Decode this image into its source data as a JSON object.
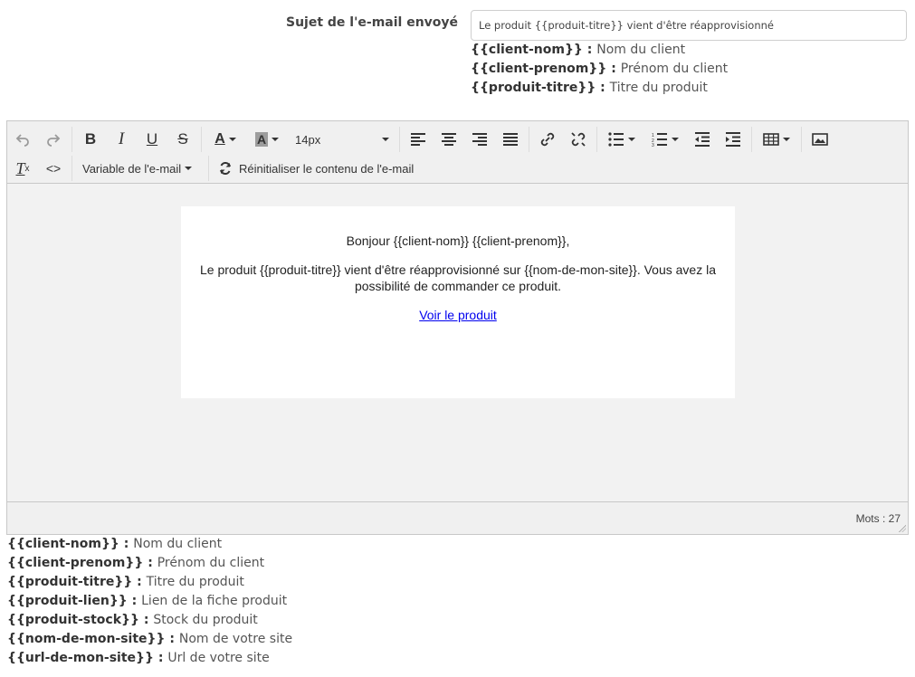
{
  "subject": {
    "label": "Sujet de l'e-mail envoyé",
    "value": "Le produit {{produit-titre}} vient d'être réapprovisionné"
  },
  "subject_vars": [
    {
      "var": "{{client-nom}}",
      "sep": " : ",
      "desc": "Nom du client"
    },
    {
      "var": "{{client-prenom}}",
      "sep": " : ",
      "desc": "Prénom du client"
    },
    {
      "var": "{{produit-titre}}",
      "sep": " : ",
      "desc": "Titre du produit"
    }
  ],
  "toolbar": {
    "font_size": "14px",
    "variable_menu": "Variable de l'e-mail",
    "reset_button": "Réinitialiser le contenu de l'e-mail",
    "icons": [
      "undo-icon",
      "redo-icon",
      "bold-icon",
      "italic-icon",
      "underline-icon",
      "strikethrough-icon",
      "text-color-icon",
      "background-color-icon",
      "align-left-icon",
      "align-center-icon",
      "align-right-icon",
      "justify-icon",
      "link-icon",
      "unlink-icon",
      "bullet-list-icon",
      "numbered-list-icon",
      "outdent-icon",
      "indent-icon",
      "table-icon",
      "image-icon",
      "clear-formatting-icon",
      "source-code-icon",
      "refresh-icon"
    ]
  },
  "email": {
    "greeting": "Bonjour {{client-nom}} {{client-prenom}},",
    "body": "Le produit {{produit-titre}} vient d'être réapprovisionné sur {{nom-de-mon-site}}. Vous avez la possibilité de commander ce produit.",
    "link_text": "Voir le produit"
  },
  "status": {
    "word_count": "Mots : 27"
  },
  "body_vars": [
    {
      "var": "{{client-nom}}",
      "sep": " : ",
      "desc": "Nom du client"
    },
    {
      "var": "{{client-prenom}}",
      "sep": " : ",
      "desc": "Prénom du client"
    },
    {
      "var": "{{produit-titre}}",
      "sep": " : ",
      "desc": "Titre du produit"
    },
    {
      "var": "{{produit-lien}}",
      "sep": " : ",
      "desc": "Lien de la fiche produit"
    },
    {
      "var": "{{produit-stock}}",
      "sep": " : ",
      "desc": "Stock du produit"
    },
    {
      "var": "{{nom-de-mon-site}}",
      "sep": " : ",
      "desc": "Nom de votre site"
    },
    {
      "var": "{{url-de-mon-site}}",
      "sep": " : ",
      "desc": "Url de votre site"
    }
  ]
}
